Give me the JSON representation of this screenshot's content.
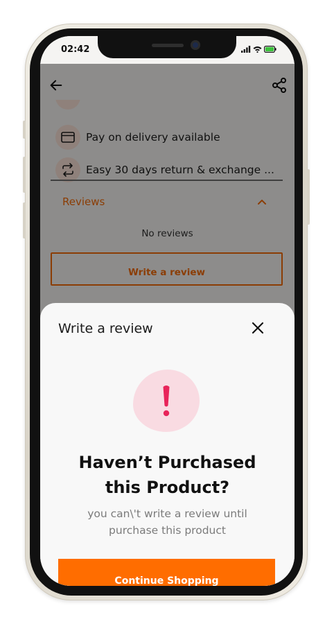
{
  "status_bar": {
    "time": "02:42",
    "icons": [
      "signal-icon",
      "wifi-icon",
      "battery-icon"
    ]
  },
  "features": [
    {
      "icon": "credit-card-icon",
      "label": "Pay on delivery available"
    },
    {
      "icon": "exchange-icon",
      "label": "Easy 30 days return & exchange ..."
    }
  ],
  "reviews": {
    "title": "Reviews",
    "empty_text": "No reviews",
    "write_button": "Write a review"
  },
  "sheet": {
    "title": "Write a review",
    "heading_line1": "Haven’t Purchased",
    "heading_line2": "this Product?",
    "message_line1": "you can\\'t write a review until",
    "message_line2": "purchase this product",
    "cta": "Continue Shopping"
  },
  "colors": {
    "accent": "#ff6d00",
    "alert_bg": "#f9dbe2",
    "alert_icon": "#e8245a",
    "battery": "#3cc43c"
  }
}
